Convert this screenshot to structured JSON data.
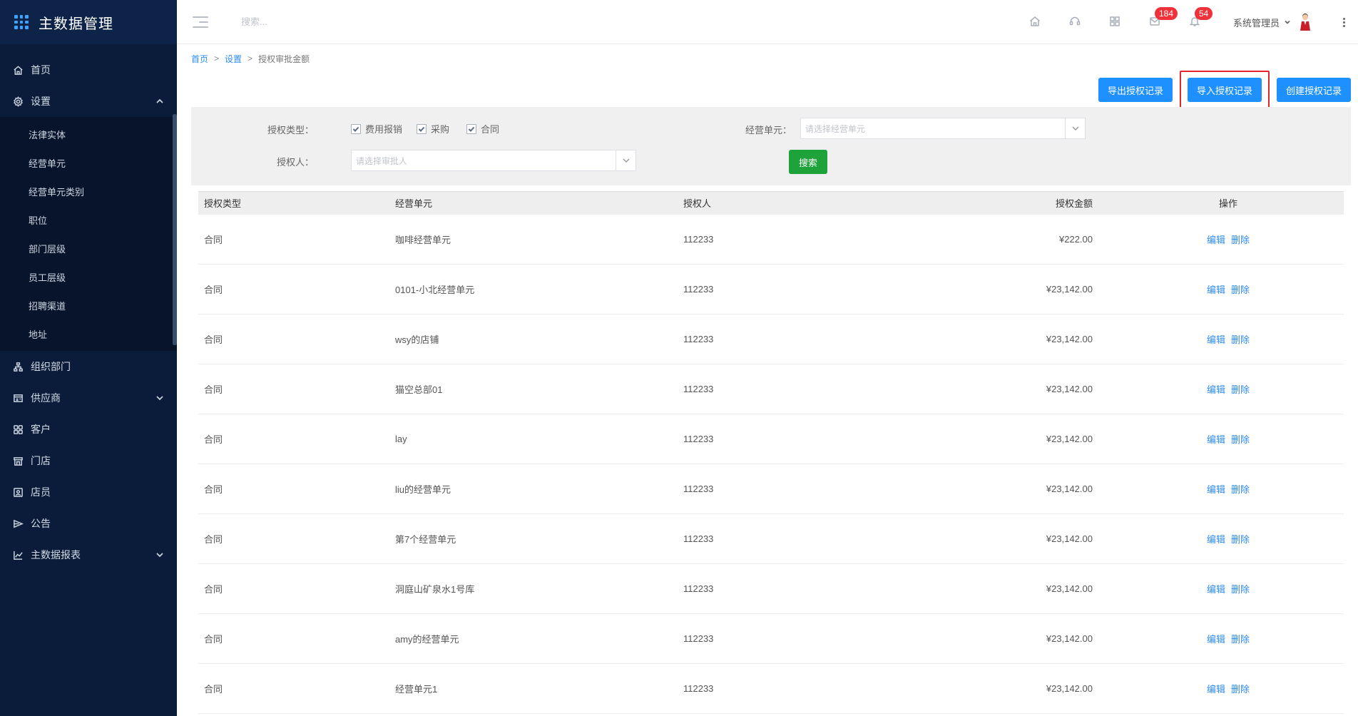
{
  "app": {
    "title": "主数据管理"
  },
  "sidebar": {
    "items": [
      {
        "label": "首页",
        "icon": "home-icon"
      },
      {
        "label": "设置",
        "icon": "gear-icon",
        "expanded": true,
        "children": [
          "法律实体",
          "经营单元",
          "经营单元类别",
          "职位",
          "部门层级",
          "员工层级",
          "招聘渠道",
          "地址"
        ]
      },
      {
        "label": "组织部门",
        "icon": "org-icon"
      },
      {
        "label": "供应商",
        "icon": "supplier-icon",
        "expandable": true
      },
      {
        "label": "客户",
        "icon": "customer-icon"
      },
      {
        "label": "门店",
        "icon": "store-icon"
      },
      {
        "label": "店员",
        "icon": "clerk-icon"
      },
      {
        "label": "公告",
        "icon": "announce-icon"
      },
      {
        "label": "主数据报表",
        "icon": "report-icon",
        "expandable": true
      }
    ]
  },
  "header": {
    "search_placeholder": "搜索...",
    "badge_messages": "184",
    "badge_notifications": "54",
    "user_name": "系统管理员"
  },
  "breadcrumb": {
    "home": "首页",
    "settings": "设置",
    "current": "授权审批金额",
    "sep": ">"
  },
  "actions": {
    "export": "导出授权记录",
    "import": "导入授权记录",
    "create": "创建授权记录"
  },
  "filter": {
    "type_label": "授权类型：",
    "types": [
      "费用报销",
      "采购",
      "合同"
    ],
    "unit_label": "经营单元：",
    "unit_placeholder": "请选择经营单元",
    "approver_label": "授权人：",
    "approver_placeholder": "请选择审批人",
    "search_button": "搜索"
  },
  "table": {
    "headers": [
      "授权类型",
      "经营单元",
      "授权人",
      "授权金额",
      "操作"
    ],
    "edit": "编辑",
    "delete": "删除",
    "rows": [
      {
        "type": "合同",
        "unit": "咖啡经营单元",
        "approver": "112233",
        "amount": "¥222.00"
      },
      {
        "type": "合同",
        "unit": "0101-小北经营单元",
        "approver": "112233",
        "amount": "¥23,142.00"
      },
      {
        "type": "合同",
        "unit": "wsy的店铺",
        "approver": "112233",
        "amount": "¥23,142.00"
      },
      {
        "type": "合同",
        "unit": "猫空总部01",
        "approver": "112233",
        "amount": "¥23,142.00"
      },
      {
        "type": "合同",
        "unit": "lay",
        "approver": "112233",
        "amount": "¥23,142.00"
      },
      {
        "type": "合同",
        "unit": "liu的经营单元",
        "approver": "112233",
        "amount": "¥23,142.00"
      },
      {
        "type": "合同",
        "unit": "第7个经营单元",
        "approver": "112233",
        "amount": "¥23,142.00"
      },
      {
        "type": "合同",
        "unit": "洞庭山矿泉水1号库",
        "approver": "112233",
        "amount": "¥23,142.00"
      },
      {
        "type": "合同",
        "unit": "amy的经营单元",
        "approver": "112233",
        "amount": "¥23,142.00"
      },
      {
        "type": "合同",
        "unit": "经营单元1",
        "approver": "112233",
        "amount": "¥23,142.00"
      }
    ]
  },
  "colors": {
    "sidebar_bg": "#0a1c3a",
    "primary": "#1e90ff",
    "search_green": "#1ea23a",
    "badge_red": "#f0313a",
    "highlight_red": "#e4252b"
  }
}
